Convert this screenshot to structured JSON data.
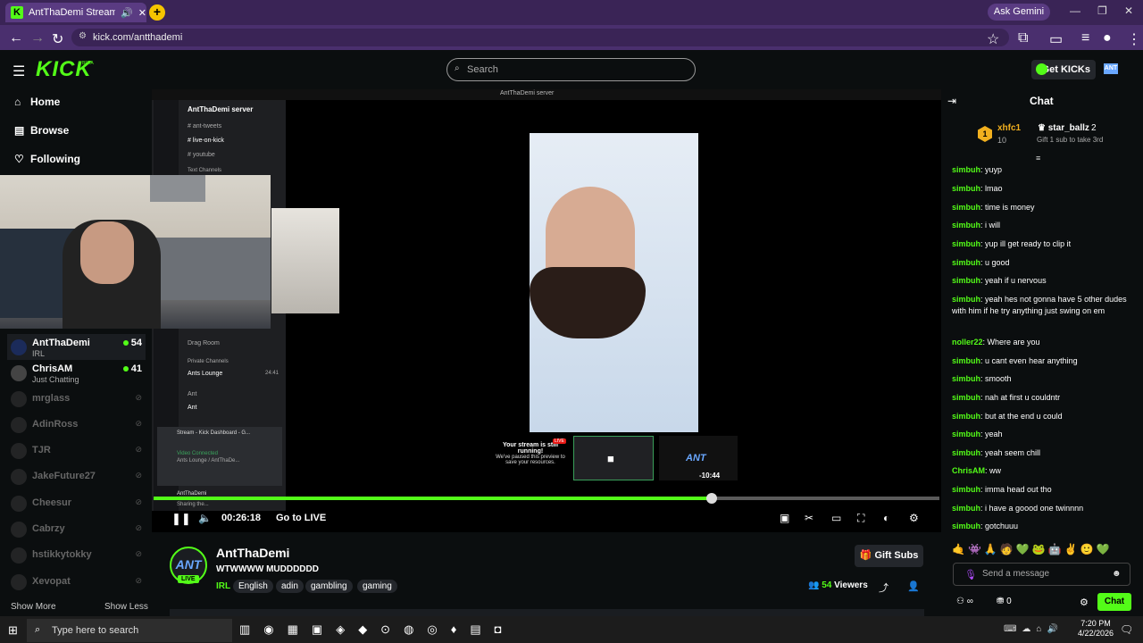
{
  "browser": {
    "tab_title": "AntThaDemi Stream - Watc",
    "ask_gemini": "Ask Gemini",
    "url": "kick.com/antthademi"
  },
  "header": {
    "search_placeholder": "Search",
    "get_kicks": "Get KICKs",
    "avatar_text": "ANT",
    "logo": "KICK",
    "beta": "BETA"
  },
  "sidebar": {
    "nav": [
      {
        "label": "Home",
        "icon": "home-icon"
      },
      {
        "label": "Browse",
        "icon": "browse-icon"
      },
      {
        "label": "Following",
        "icon": "heart-icon"
      }
    ],
    "channels": [
      {
        "name": "AntThaDemi",
        "category": "IRL",
        "viewers": "54",
        "live": true
      },
      {
        "name": "ChrisAM",
        "category": "Just Chatting",
        "viewers": "41",
        "live": true
      },
      {
        "name": "mrglass",
        "live": false
      },
      {
        "name": "AdinRoss",
        "live": false
      },
      {
        "name": "TJR",
        "live": false
      },
      {
        "name": "JakeFuture27",
        "live": false
      },
      {
        "name": "Cheesur",
        "live": false
      },
      {
        "name": "Cabrzy",
        "live": false
      },
      {
        "name": "hstikkytokky",
        "live": false
      },
      {
        "name": "Xevopat",
        "live": false
      }
    ],
    "show_more": "Show More",
    "show_less": "Show Less"
  },
  "video": {
    "discord_title": "AntThaDemi server",
    "discord_server": "AntThaDemi server",
    "discord_channels": [
      "ant-tweets",
      "live-on-kick",
      "youtube"
    ],
    "discord_voice": [
      "Drag Room",
      "Ants Lounge",
      "Ant",
      "Ant"
    ],
    "discord_section": "Text Channels",
    "discord_private": "Private Channels",
    "ants_lounge_time": "24:41",
    "discord_stream_label": "Stream - Kick Dashboard - G...",
    "discord_video_connected": "Video Connected",
    "discord_lounge_path": "Ants Lounge / AntThaDe...",
    "discord_user": "AntThaDemi",
    "discord_sharing": "Sharing the...",
    "still_running_title": "Your stream is still running!",
    "still_running_text": "We've paused this preview to save your resources.",
    "live_small": "LIVE",
    "tile_logo": "ANT",
    "seek_time": "-10:44",
    "progress": 0.71,
    "current_time": "00:26:18",
    "go_to_live": "Go to LIVE"
  },
  "stream_info": {
    "name": "AntThaDemi",
    "title": "WTWWWW MUDDDDDD",
    "category": "IRL",
    "tags": [
      "English",
      "adin",
      "gambling",
      "gaming"
    ],
    "live": "LIVE",
    "avatar_text": "ANT",
    "gift_subs": "Gift Subs",
    "viewers": "54",
    "viewers_label": "Viewers"
  },
  "chat": {
    "title": "Chat",
    "pinned": {
      "rank": "1",
      "user1": "xhfc1",
      "count1": "10",
      "user2": "star_ballz",
      "count2": "2",
      "gift_text": "Gift 1 sub to take 3rd"
    },
    "messages": [
      {
        "user": "simbuh",
        "text": "yuyp",
        "color": "#53fc18"
      },
      {
        "user": "simbuh",
        "text": "lmao",
        "color": "#53fc18"
      },
      {
        "user": "simbuh",
        "text": "time is money",
        "color": "#53fc18"
      },
      {
        "user": "simbuh",
        "text": "i will",
        "color": "#53fc18"
      },
      {
        "user": "simbuh",
        "text": "yup ill get ready to clip it",
        "color": "#53fc18"
      },
      {
        "user": "simbuh",
        "text": "u good",
        "color": "#53fc18"
      },
      {
        "user": "simbuh",
        "text": "yeah if u nervous",
        "color": "#53fc18"
      },
      {
        "user": "simbuh",
        "text": "yeah hes not gonna have 5 other dudes with him if he try anything just swing on em",
        "color": "#53fc18"
      },
      {
        "user": "noller22",
        "text": "Where are you",
        "color": "#53fc18"
      },
      {
        "user": "simbuh",
        "text": "u cant even hear anything",
        "color": "#53fc18"
      },
      {
        "user": "simbuh",
        "text": "smooth",
        "color": "#53fc18"
      },
      {
        "user": "simbuh",
        "text": "nah at first u couldntr",
        "color": "#53fc18"
      },
      {
        "user": "simbuh",
        "text": "but at the end u could",
        "color": "#53fc18"
      },
      {
        "user": "simbuh",
        "text": "yeah",
        "color": "#53fc18"
      },
      {
        "user": "simbuh",
        "text": "yeah seem chill",
        "color": "#53fc18"
      },
      {
        "user": "ChrisAM",
        "text": "ww",
        "color": "#53fc18"
      },
      {
        "user": "simbuh",
        "text": "imma head out tho",
        "color": "#53fc18"
      },
      {
        "user": "simbuh",
        "text": "i have a goood one twinnnn",
        "color": "#53fc18"
      },
      {
        "user": "simbuh",
        "text": "gotchuuu",
        "color": "#53fc18"
      }
    ],
    "input_placeholder": "Send a message",
    "kicks_count": "0",
    "infinity": "∞",
    "send_label": "Chat"
  },
  "taskbar": {
    "search_placeholder": "Type here to search",
    "time": "7:20 PM",
    "date": "4/22/2026"
  },
  "colors": {
    "accent": "#53fc18",
    "background": "#0b0e0f",
    "browser": "#4a2f6e"
  }
}
